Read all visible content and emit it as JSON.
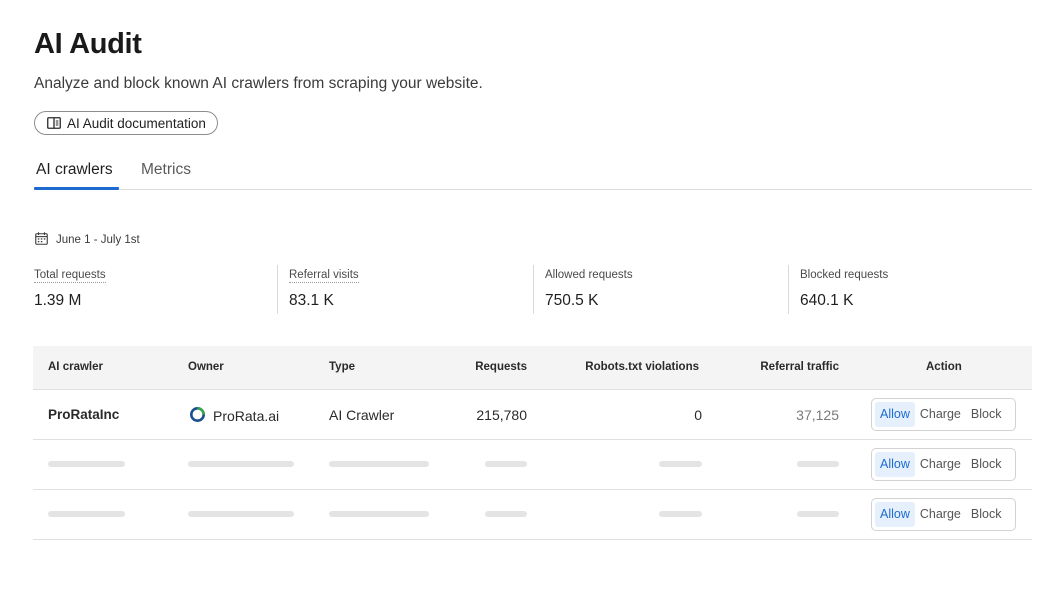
{
  "header": {
    "title": "AI Audit",
    "subtitle": "Analyze and block known AI crawlers from scraping your website.",
    "doc_link_label": "AI Audit documentation"
  },
  "tabs": [
    {
      "label": "AI crawlers",
      "active": true
    },
    {
      "label": "Metrics",
      "active": false
    }
  ],
  "date_range": "June 1 - July 1st",
  "stats": [
    {
      "label": "Total requests",
      "value": "1.39 M"
    },
    {
      "label": "Referral visits",
      "value": "83.1 K"
    },
    {
      "label": "Allowed requests",
      "value": "750.5 K"
    },
    {
      "label": "Blocked requests",
      "value": "640.1 K"
    }
  ],
  "table": {
    "columns": [
      "AI crawler",
      "Owner",
      "Type",
      "Requests",
      "Robots.txt violations",
      "Referral traffic",
      "Action"
    ],
    "rows": [
      {
        "crawler": "ProRataInc",
        "owner": "ProRata.ai",
        "type": "AI Crawler",
        "requests": "215,780",
        "robots_violations": "0",
        "referral_traffic": "37,125",
        "action": "Allow"
      }
    ],
    "placeholder_rows": 2,
    "action_options": [
      "Allow",
      "Charge",
      "Block"
    ]
  },
  "colors": {
    "accent": "#1d6bd1",
    "selected_bg": "#e6f0fc",
    "header_bg": "#f4f4f4",
    "skeleton": "#e4e4e4"
  },
  "icons": {
    "doc_link": "book-icon",
    "date": "calendar-icon",
    "owner": "prorata-logo-icon"
  }
}
